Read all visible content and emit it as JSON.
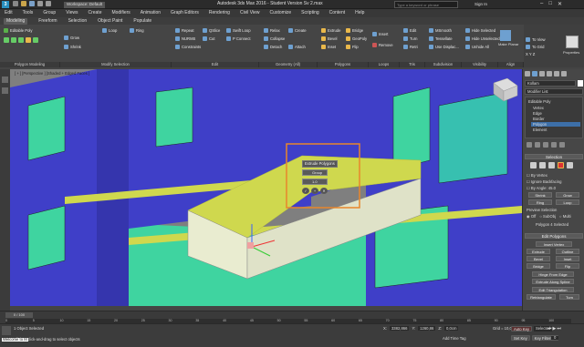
{
  "app": {
    "title": "Autodesk 3ds Max 2016 - Student Version   Sv 2.max",
    "workspace": "Workspace: Default",
    "search_placeholder": "Type a keyword or phrase",
    "user": "Sign In"
  },
  "menu": [
    "Edit",
    "Tools",
    "Group",
    "Views",
    "Create",
    "Modifiers",
    "Animation",
    "Graph Editors",
    "Rendering",
    "Civil View",
    "Customize",
    "Scripting",
    "Content",
    "Help"
  ],
  "ribbon_tabs": [
    "Modeling",
    "Freeform",
    "Selection",
    "Object Paint",
    "Populate"
  ],
  "ribbon_active_tab": "Modeling",
  "ribbon": {
    "polygon_modeling": {
      "editable": "Editable Poly",
      "label": "Polygon Modeling"
    },
    "modify_selection": {
      "items": [
        "Grow",
        "Shrink",
        "Loop",
        "Ring"
      ],
      "label": "Modify Selection"
    },
    "edit": {
      "items": [
        "Repeat",
        "QSlice",
        "Swift Loop",
        "NURMS",
        "Cut",
        "P Connect",
        "Constraints"
      ],
      "label": "Edit"
    },
    "geometry": {
      "items": [
        "Relax",
        "Create",
        "Collapse",
        "Detach",
        "Attach"
      ],
      "label": "Geometry (All)"
    },
    "polygons": {
      "items": [
        "Extrude",
        "Bevel",
        "Inset",
        "Bridge",
        "GeoPoly",
        "Flip"
      ],
      "label": "Polygons"
    },
    "loops": {
      "items": [
        "Insert",
        "Remove"
      ],
      "label": "Loops"
    },
    "tris": {
      "items": [
        "Edit",
        "Turn",
        "Retri"
      ],
      "label": "Tris"
    },
    "subdivision": {
      "items": [
        "MSmooth",
        "Tessellate",
        "Use Displac..."
      ],
      "label": "Subdivision"
    },
    "visibility": {
      "items": [
        "Hide Selected",
        "Hide Unselected",
        "Unhide All"
      ],
      "label": "Visibility"
    },
    "align": {
      "items": [
        "Make Planar",
        "To View",
        "To Grid",
        "X Y Z"
      ],
      "label": "Align"
    },
    "properties": {
      "label": "Properties"
    }
  },
  "viewport": {
    "label": "[ + ] [Perspective ] [Shaded + Edged Faces ]",
    "caddy": {
      "title": "Extrude Polygons",
      "height_value": "1.0",
      "mode": "Group",
      "ok_label": "✓",
      "apply_label": "+",
      "cancel_label": "✕"
    }
  },
  "command_panel": {
    "object_name": "Kollam",
    "modifier_list": "Modifier List",
    "stack": [
      "Editable Poly",
      "Vertex",
      "Edge",
      "Border",
      "Polygon",
      "Element"
    ],
    "stack_selected": "Polygon",
    "selection": {
      "title": "Selection",
      "by_vertex": "By Vertex",
      "ignore_backfacing": "Ignore Backfacing",
      "by_angle": "By Angle:",
      "angle_value": "45.0",
      "shrink": "Shrink",
      "grow": "Grow",
      "ring": "Ring",
      "loop": "Loop",
      "preview_selection": "Preview Selection",
      "off": "Off",
      "subobj": "SubObj",
      "multi": "Multi",
      "status": "Polygon 4 Selected"
    },
    "edit_polygons": {
      "title": "Edit Polygons",
      "insert_vertex": "Insert Vertex",
      "extrude": "Extrude",
      "outline": "Outline",
      "bevel": "Bevel",
      "inset": "Inset",
      "bridge": "Bridge",
      "flip": "Flip",
      "hinge": "Hinge From Edge",
      "extrude_spline": "Extrude Along Spline",
      "edit_triangulation": "Edit Triangulation",
      "retriangulate": "Retriangulate",
      "turn": "Turn"
    }
  },
  "timeline": {
    "frame_label": "0 / 100",
    "ticks": [
      "0",
      "5",
      "10",
      "15",
      "20",
      "25",
      "30",
      "35",
      "40",
      "45",
      "50",
      "55",
      "60",
      "65",
      "70",
      "75",
      "80",
      "85",
      "90",
      "95",
      "100"
    ]
  },
  "status": {
    "selection": "1 Object Selected",
    "hint": "Click or click-and-drag to select objects",
    "x_label": "X:",
    "x_value": "3382,866",
    "y_label": "Y:",
    "y_value": "1260,86",
    "z_label": "Z:",
    "z_value": "0,0cm",
    "grid": "Grid = 10,0cm",
    "auto_key": "Auto Key",
    "selected": "Selected",
    "set_key": "Set Key",
    "key_filters": "Key Filters...",
    "add_time_tag": "Add Time Tag",
    "frame": "0",
    "welcome": "Welcome to M"
  },
  "colors": {
    "accent": "#e8862b",
    "selected_face": "#cfd84e",
    "walls": "#3f3fc8",
    "green_faces": "#3fd4a0"
  }
}
